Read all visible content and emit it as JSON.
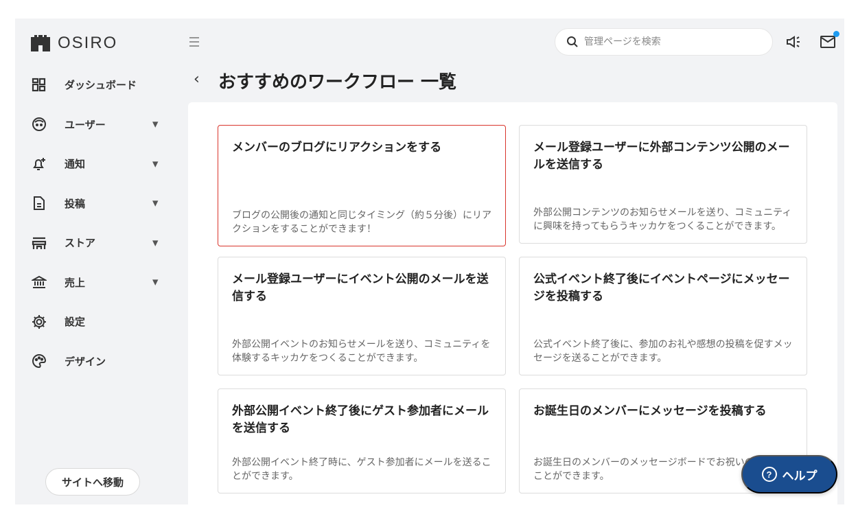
{
  "app": {
    "brand": "OSIRO"
  },
  "sidebar": {
    "items": [
      {
        "label": "ダッシュボード",
        "icon": "dashboard-icon",
        "has_caret": false
      },
      {
        "label": "ユーザー",
        "icon": "user-face-icon",
        "has_caret": true
      },
      {
        "label": "通知",
        "icon": "bell-plus-icon",
        "has_caret": true
      },
      {
        "label": "投稿",
        "icon": "document-icon",
        "has_caret": true
      },
      {
        "label": "ストア",
        "icon": "store-icon",
        "has_caret": true
      },
      {
        "label": "売上",
        "icon": "bank-icon",
        "has_caret": true
      },
      {
        "label": "設定",
        "icon": "gear-icon",
        "has_caret": false
      },
      {
        "label": "デザイン",
        "icon": "palette-icon",
        "has_caret": false
      }
    ],
    "caret": "▼",
    "site_button": "サイトへ移動"
  },
  "header": {
    "search_placeholder": "管理ページを検索",
    "has_notification": true
  },
  "page": {
    "back_glyph": "‹",
    "title": "おすすめのワークフロー 一覧"
  },
  "cards": [
    {
      "title": "メンバーのブログにリアクションをする",
      "description": "ブログの公開後の通知と同じタイミング（約５分後）にリアクションをすることができます！",
      "selected": true
    },
    {
      "title": "メール登録ユーザーに外部コンテンツ公開のメールを送信する",
      "description": "外部公開コンテンツのお知らせメールを送り、コミュニティに興味を持ってもらうキッカケをつくることができます。",
      "selected": false
    },
    {
      "title": "メール登録ユーザーにイベント公開のメールを送信する",
      "description": "外部公開イベントのお知らせメールを送り、コミュニティを体験するキッカケをつくることができます。",
      "selected": false
    },
    {
      "title": "公式イベント終了後にイベントページにメッセージを投稿する",
      "description": "公式イベント終了後に、参加のお礼や感想の投稿を促すメッセージを送ることができます。",
      "selected": false
    },
    {
      "title": "外部公開イベント終了後にゲスト参加者にメールを送信する",
      "description": "外部公開イベント終了時に、ゲスト参加者にメールを送ることができます。",
      "selected": false
    },
    {
      "title": "お誕生日のメンバーにメッセージを投稿する",
      "description": "お誕生日のメンバーのメッセージボードでお祝いの投稿することができます。",
      "selected": false
    }
  ],
  "help": {
    "label": "ヘルプ",
    "icon_glyph": "?"
  },
  "colors": {
    "accent_selected": "#d9342b",
    "help_button": "#1a4d8f",
    "notification_dot": "#1e9bf0"
  }
}
